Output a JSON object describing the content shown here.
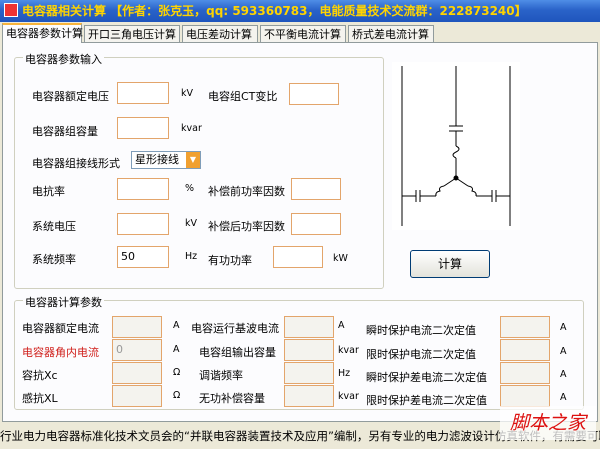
{
  "window": {
    "title": "电容器相关计算  【作者：张克玉，qq: 593360783，电能质量技术交流群：222873240】"
  },
  "tabs": [
    {
      "label": "电容器参数计算",
      "active": true
    },
    {
      "label": "开口三角电压计算",
      "active": false
    },
    {
      "label": "电压差动计算",
      "active": false
    },
    {
      "label": "不平衡电流计算",
      "active": false
    },
    {
      "label": "桥式差电流计算",
      "active": false
    }
  ],
  "input_group": {
    "title": "电容器参数输入",
    "rated_voltage": {
      "label": "电容器额定电压",
      "unit": "kV",
      "value": ""
    },
    "ct_ratio": {
      "label": "电容组CT变比",
      "value": ""
    },
    "capacity": {
      "label": "电容器组容量",
      "unit": "kvar",
      "value": ""
    },
    "wiring": {
      "label": "电容器组接线形式",
      "selected": "星形接线"
    },
    "reactance_rate": {
      "label": "电抗率",
      "unit": "%",
      "value": ""
    },
    "pf_before": {
      "label": "补偿前功率因数",
      "value": ""
    },
    "system_voltage": {
      "label": "系统电压",
      "unit": "kV",
      "value": ""
    },
    "pf_after": {
      "label": "补偿后功率因数",
      "value": ""
    },
    "system_freq": {
      "label": "系统频率",
      "unit": "Hz",
      "value": "50"
    },
    "active_power": {
      "label": "有功功率",
      "unit": "kW",
      "value": ""
    }
  },
  "calc_button": {
    "label": "计算"
  },
  "output_group": {
    "title": "电容器计算参数",
    "rows": [
      [
        {
          "label": "电容器额定电流",
          "unit": "A",
          "value": "",
          "color": "#000000"
        },
        {
          "label": "电容运行基波电流",
          "unit": "A",
          "value": ""
        },
        {
          "label": "瞬时保护电流二次定值",
          "unit": "A",
          "value": ""
        }
      ],
      [
        {
          "label": "电容器角内电流",
          "unit": "A",
          "value": "0",
          "color": "#d0201c"
        },
        {
          "label": "电容组输出容量",
          "unit": "kvar",
          "value": ""
        },
        {
          "label": "限时保护电流二次定值",
          "unit": "A",
          "value": ""
        }
      ],
      [
        {
          "label": "容抗Xc",
          "unit": "Ω",
          "value": "",
          "color": "#000000"
        },
        {
          "label": "调谐频率",
          "unit": "Hz",
          "value": ""
        },
        {
          "label": "瞬时保护差电流二次定值",
          "unit": "A",
          "value": ""
        }
      ],
      [
        {
          "label": "感抗XL",
          "unit": "Ω",
          "value": "",
          "color": "#000000"
        },
        {
          "label": "无功补偿容量",
          "unit": "kvar",
          "value": ""
        },
        {
          "label": "限时保护差电流二次定值",
          "unit": "A",
          "value": ""
        }
      ]
    ]
  },
  "status": {
    "text": "行业电力电容器标准化技术文员会的“并联电容器装置技术及应用”编制，另有专业的电力滤波设计仿真软件，有需要可联系"
  },
  "watermark": {
    "text": "脚本之家"
  },
  "colors": {
    "accent": "#f8b43c",
    "field_border": "#e3a56b",
    "warn_text": "#d0201c",
    "title_text": "#ffd400"
  }
}
